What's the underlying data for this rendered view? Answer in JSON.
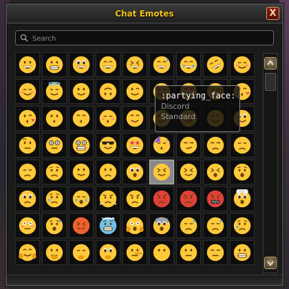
{
  "window": {
    "title": "Chat Emotes",
    "close_label": "X"
  },
  "search": {
    "placeholder": "Search",
    "value": ""
  },
  "tooltip": {
    "name": ":partying_face:",
    "source": "Discord",
    "category": "Standard"
  },
  "grid": {
    "hovered_index": 41,
    "emotes": [
      "grinning",
      "grin",
      "smiley",
      "smile",
      "laughing",
      "sweat_smile",
      "joy",
      "rofl",
      "relaxed",
      "blush",
      "innocent",
      "slight_smile",
      "upside_down",
      "wink",
      "relieved",
      "heart_eyes",
      "smiling_hearts",
      "kissing_heart",
      "kissing_heart",
      "kissing",
      "kissing_smiling",
      "kissing_closed_eyes",
      "yum",
      "stuck_out_tongue",
      "squint_tongue",
      "wink_tongue",
      "zany",
      "raised_eyebrow",
      "monocle",
      "nerd",
      "sunglasses",
      "star_struck",
      "partying_face",
      "smirk",
      "unamused",
      "disappointed",
      "pensive",
      "worried",
      "confused",
      "slightly_frowning",
      "frowning",
      "persevere",
      "confounded",
      "tired",
      "weary",
      "pleading",
      "cry",
      "sob",
      "triumph",
      "angry",
      "rage",
      "pout",
      "symbols_over_mouth",
      "exploding_head",
      "flushed",
      "cold_sweat",
      "hot_face",
      "cold_face",
      "scream",
      "fearful",
      "disappointed_relieved",
      "sweat",
      "sad_relieved",
      "hugging",
      "thinking",
      "hand_over_mouth",
      "shushing",
      "lying",
      "no_mouth",
      "neutral",
      "expressionless",
      "grimacing"
    ]
  },
  "scrollbar": {
    "position": 0.0
  },
  "colors": {
    "title": "#f2c318",
    "face": "#ffc93c",
    "face_shade": "#e89b14",
    "feature": "#664500",
    "blush": "#ff7b8a",
    "tear": "#5dadec",
    "angry_face": "#e0403a"
  }
}
